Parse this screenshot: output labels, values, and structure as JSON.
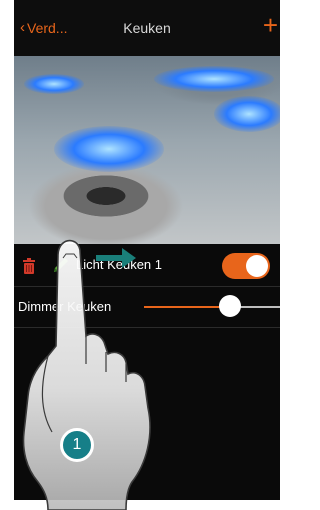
{
  "nav": {
    "back_label": "Verd...",
    "title": "Keuken",
    "add_label": "+"
  },
  "scenario": {
    "item_name": "Licht Keuken 1",
    "toggle_on": true
  },
  "dimmer": {
    "label": "Dimmer Keuken",
    "level": 0.68
  },
  "callout": {
    "number": "1"
  },
  "colors": {
    "accent": "#e8651b",
    "badge": "#167f88",
    "trash": "#d23a2a",
    "pencil": "#5fae3b"
  }
}
